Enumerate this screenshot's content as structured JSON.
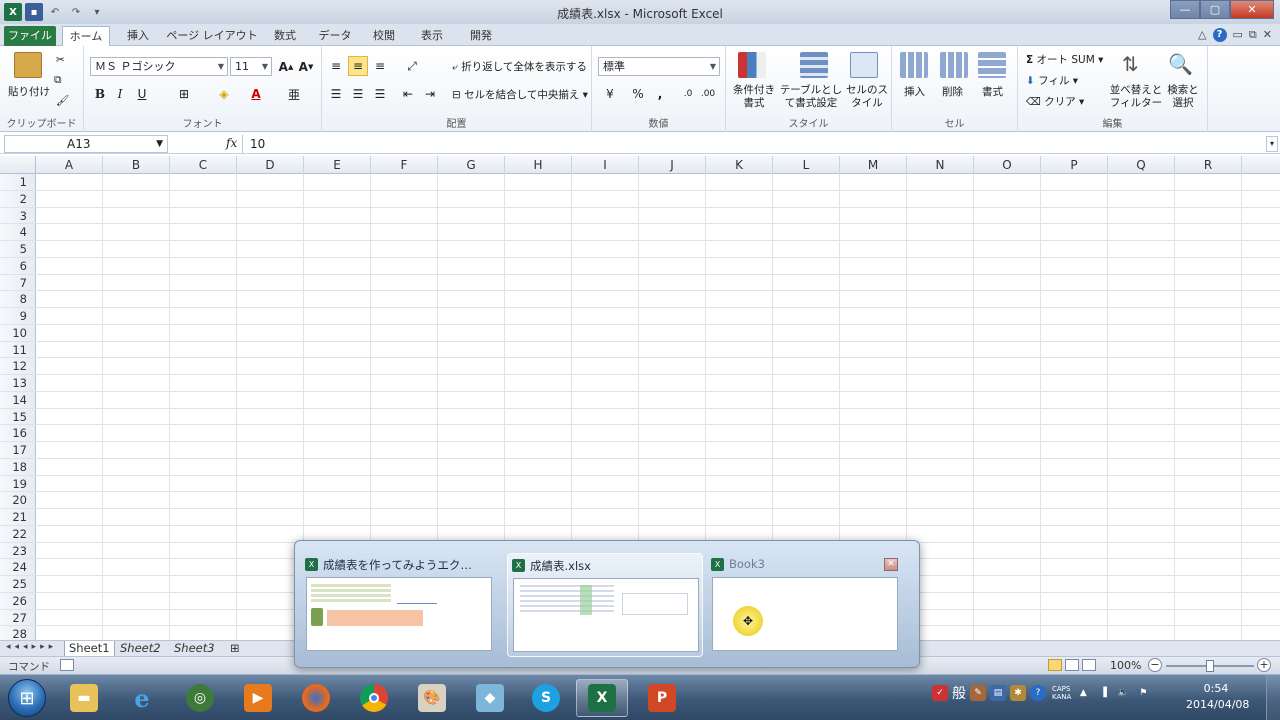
{
  "window": {
    "title": "成績表.xlsx - Microsoft Excel",
    "minimize": "—",
    "maximize": "▢",
    "close": "✕"
  },
  "tabs": [
    {
      "label": "ファイル"
    },
    {
      "label": "ホーム"
    },
    {
      "label": "挿入"
    },
    {
      "label": "ページ レイアウト"
    },
    {
      "label": "数式"
    },
    {
      "label": "データ"
    },
    {
      "label": "校閲"
    },
    {
      "label": "表示"
    },
    {
      "label": "開発"
    }
  ],
  "ribbon": {
    "clipboard": {
      "paste": "貼り付け",
      "label": "クリップボード"
    },
    "font": {
      "name": "ＭＳ Ｐゴシック",
      "size": "11",
      "label": "フォント"
    },
    "alignment": {
      "wrap": "折り返して全体を表示する",
      "merge": "セルを結合して中央揃え",
      "label": "配置"
    },
    "number": {
      "format": "標準",
      "label": "数値"
    },
    "styles": {
      "conditional": "条件付き書式",
      "table": "テーブルとして書式設定",
      "cell": "セルのスタイル",
      "label": "スタイル"
    },
    "cells": {
      "insert": "挿入",
      "delete": "削除",
      "format": "書式",
      "label": "セル"
    },
    "editing": {
      "autosum": "オート SUM",
      "fill": "フィル",
      "clear": "クリア",
      "sort": "並べ替えとフィルター",
      "find": "検索と選択",
      "label": "編集"
    }
  },
  "formula_bar": {
    "name_box": "A13",
    "fx": "fx",
    "value": "10"
  },
  "columns": [
    "A",
    "B",
    "C",
    "D",
    "E",
    "F",
    "G",
    "H",
    "I",
    "J",
    "K",
    "L",
    "M",
    "N",
    "O",
    "P",
    "Q",
    "R"
  ],
  "rows": [
    "1",
    "2",
    "3",
    "4",
    "5",
    "6",
    "7",
    "8",
    "9",
    "10",
    "11",
    "12",
    "13",
    "14",
    "15",
    "16",
    "17",
    "18",
    "19",
    "20",
    "21",
    "22",
    "23",
    "24",
    "25",
    "26",
    "27",
    "28"
  ],
  "sheets": [
    "Sheet1",
    "Sheet2",
    "Sheet3"
  ],
  "status": {
    "mode": "コマンド",
    "zoom": "100%"
  },
  "thumbnails": [
    {
      "title": "成績表を作ってみようエクセ..."
    },
    {
      "title": "成績表.xlsx"
    },
    {
      "title": "Book3"
    }
  ],
  "clock": {
    "time": "0:54",
    "date": "2014/04/08"
  },
  "tray": {
    "ime": "般",
    "caps": "CAPS",
    "kana": "KANA"
  },
  "taskbar_apps": [
    "explorer",
    "internet-explorer",
    "app",
    "media-player",
    "firefox",
    "chrome",
    "paint",
    "app2",
    "skype",
    "excel",
    "powerpoint"
  ]
}
